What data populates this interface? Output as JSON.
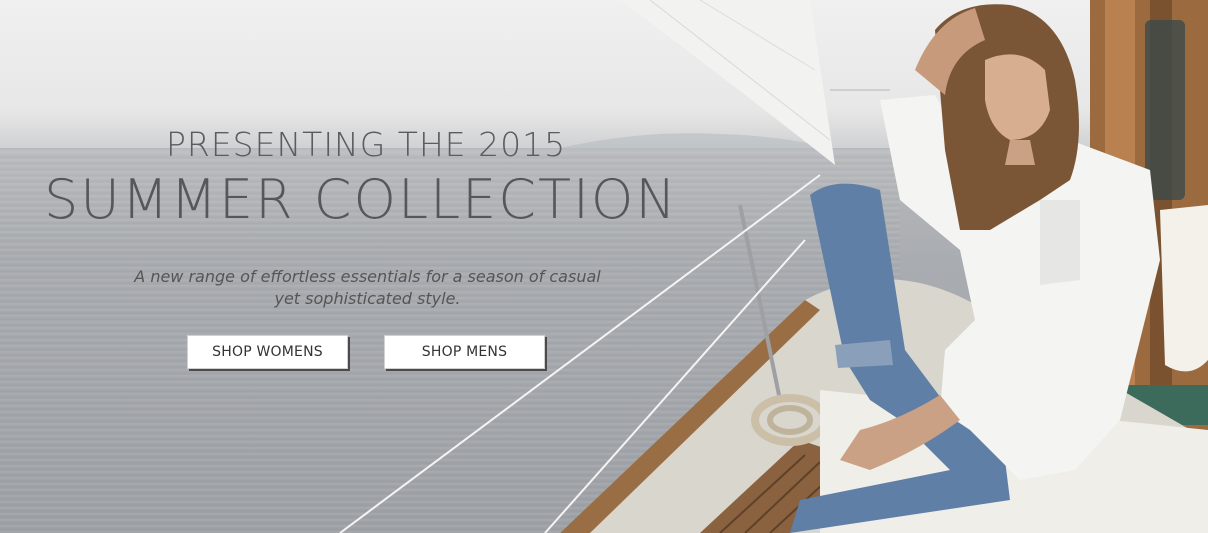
{
  "hero": {
    "headline_line1": "PRESENTING THE 2015",
    "headline_line2": "SUMMER COLLECTION",
    "subcopy_line1": "A new range of effortless essentials for a season of casual",
    "subcopy_line2": "yet sophisticated style.",
    "buttons": {
      "shop_womens": "SHOP WOMENS",
      "shop_mens": "SHOP MENS"
    }
  },
  "colors": {
    "sky": "#eeeeee",
    "sea": "#a2a6ab",
    "headline": "#55575a",
    "button_bg": "#ffffff",
    "button_shadow": "#4a4a4a"
  }
}
